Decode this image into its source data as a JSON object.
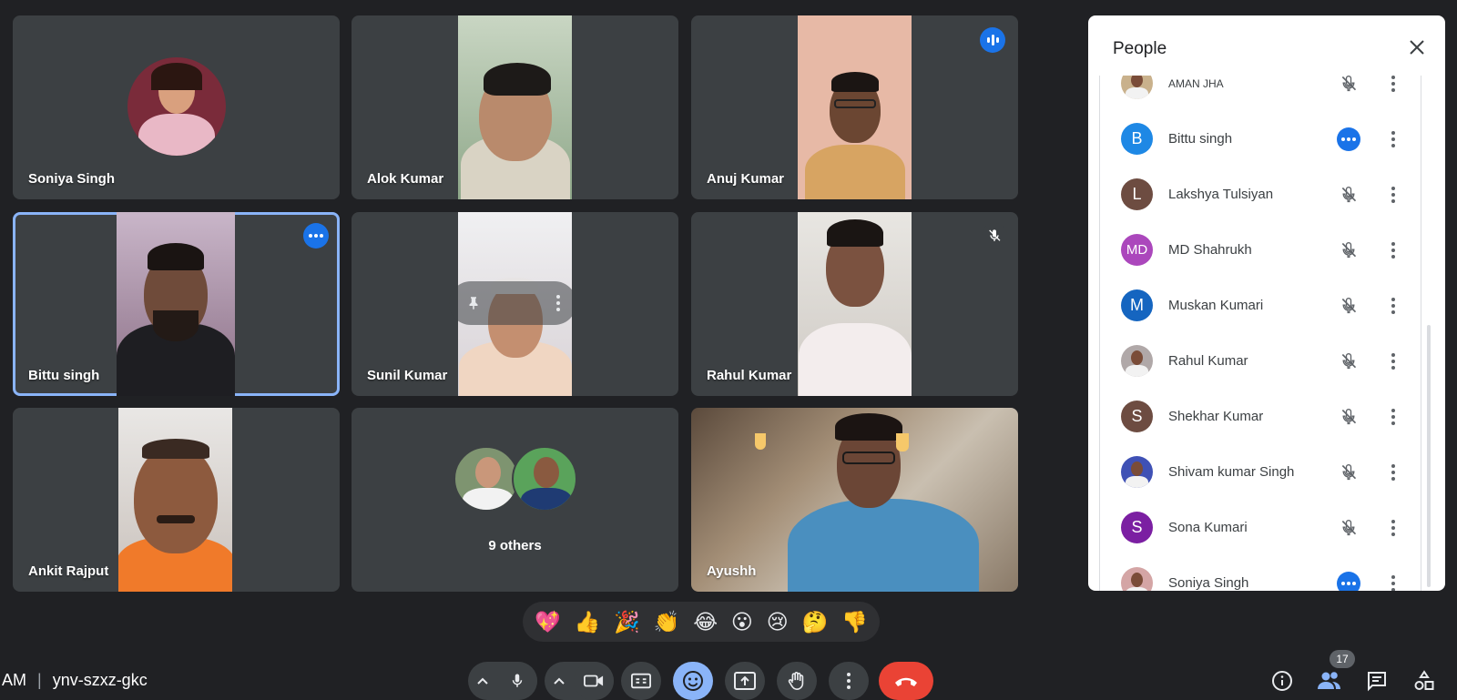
{
  "tiles": [
    {
      "name": "Soniya Singh"
    },
    {
      "name": "Alok Kumar"
    },
    {
      "name": "Anuj Kumar"
    },
    {
      "name": "Bittu singh"
    },
    {
      "name": "Sunil Kumar"
    },
    {
      "name": "Rahul Kumar"
    },
    {
      "name": "Ankit Rajput"
    },
    {
      "name": "9 others"
    },
    {
      "name": "Ayushh"
    }
  ],
  "panel": {
    "title": "People",
    "participants": [
      {
        "name": "AMAN JHA",
        "initials": "",
        "color": "#c9b18c",
        "status": "muted"
      },
      {
        "name": "Bittu singh",
        "initials": "B",
        "color": "#1e88e5",
        "status": "speaking"
      },
      {
        "name": "Lakshya Tulsiyan",
        "initials": "L",
        "color": "#6d4c41",
        "status": "muted"
      },
      {
        "name": "MD Shahrukh",
        "initials": "MD",
        "color": "#ab47bc",
        "status": "muted"
      },
      {
        "name": "Muskan Kumari",
        "initials": "M",
        "color": "#1565c0",
        "status": "muted"
      },
      {
        "name": "Rahul Kumar",
        "initials": "",
        "color": "#b0a8a8",
        "status": "muted"
      },
      {
        "name": "Shekhar Kumar",
        "initials": "S",
        "color": "#6d4c41",
        "status": "muted"
      },
      {
        "name": "Shivam kumar Singh",
        "initials": "",
        "color": "#3f51b5",
        "status": "muted"
      },
      {
        "name": "Sona Kumari",
        "initials": "S",
        "color": "#7b1fa2",
        "status": "muted"
      },
      {
        "name": "Soniya Singh",
        "initials": "",
        "color": "#d4a5a5",
        "status": "speaking"
      }
    ]
  },
  "reactions": [
    "💖",
    "👍",
    "🎉",
    "👏",
    "😂",
    "😮",
    "😢",
    "🤔",
    "👎"
  ],
  "meeting": {
    "time_fragment": "AM",
    "separator": "|",
    "code": "ynv-szxz-gkc"
  },
  "people_count": "17",
  "colors": {
    "accent": "#8ab4f8",
    "hangup": "#ea4335",
    "bg": "#202124",
    "tile": "#3c4043"
  }
}
